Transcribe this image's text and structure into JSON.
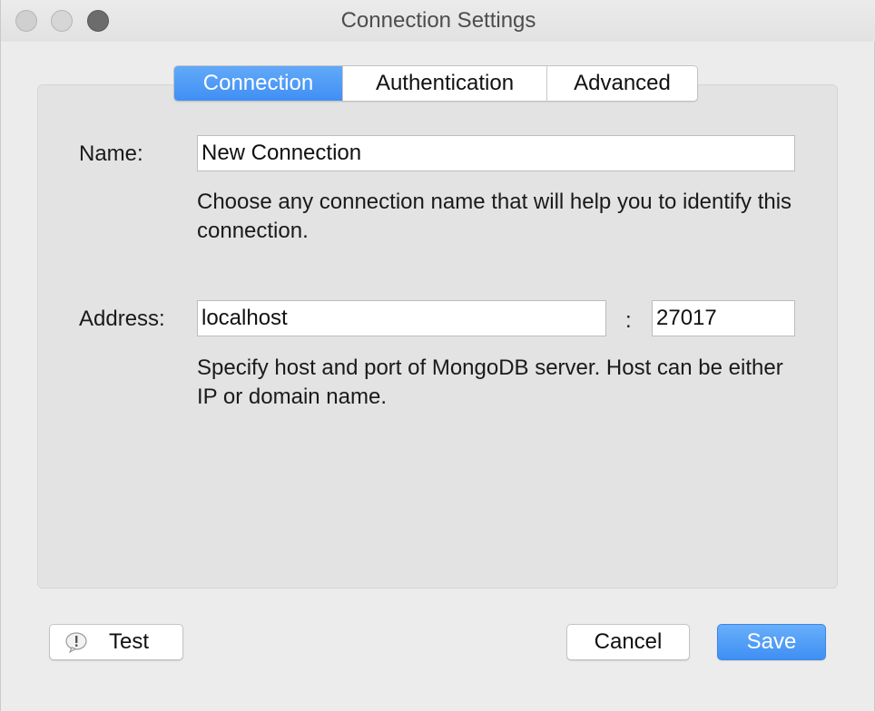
{
  "window": {
    "title": "Connection Settings"
  },
  "tabs": [
    {
      "label": "Connection",
      "active": true
    },
    {
      "label": "Authentication",
      "active": false
    },
    {
      "label": "Advanced",
      "active": false
    }
  ],
  "form": {
    "name_label": "Name:",
    "name_value": "New Connection",
    "name_help": "Choose any connection name that will help you to identify this connection.",
    "address_label": "Address:",
    "host_value": "localhost",
    "port_separator": ":",
    "port_value": "27017",
    "address_help": "Specify host and port of MongoDB server. Host can be either IP or domain name."
  },
  "buttons": {
    "test_label": "Test",
    "cancel_label": "Cancel",
    "save_label": "Save"
  },
  "icons": {
    "test_icon": "warning-speech-bubble-icon"
  },
  "colors": {
    "accent": "#3f8ff4"
  }
}
